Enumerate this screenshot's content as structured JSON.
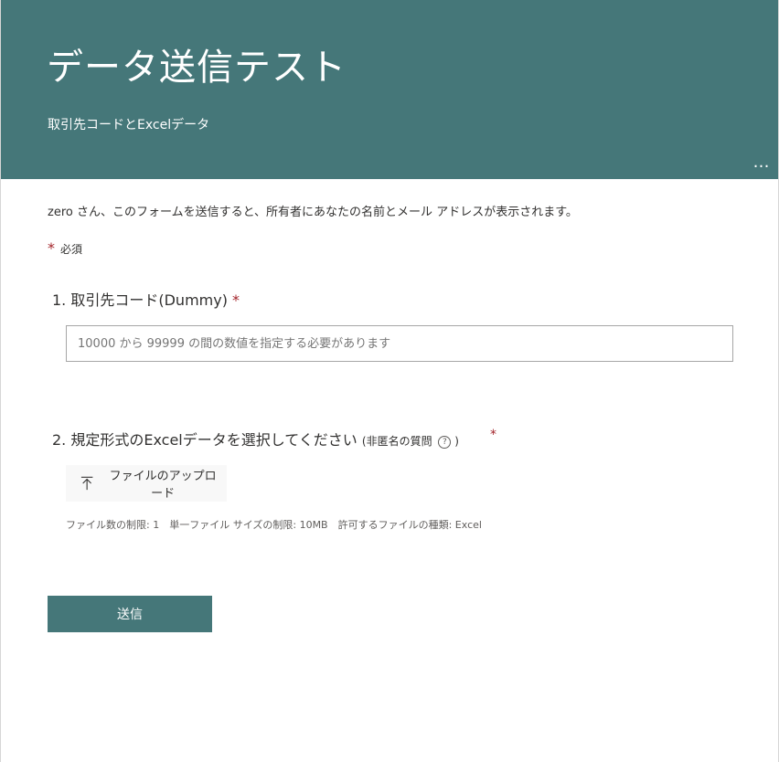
{
  "header": {
    "title": "データ送信テスト",
    "subtitle": "取引先コードとExcelデータ",
    "more_label": "…",
    "background_color": "#457779"
  },
  "notice": "zero さん、このフォームを送信すると、所有者にあなたの名前とメール アドレスが表示されます。",
  "required_legend": {
    "star": "*",
    "label": "必須"
  },
  "questions": [
    {
      "number": "1.",
      "title": "取引先コード(Dummy)",
      "required_mark": "*",
      "input_value": "",
      "placeholder": "10000 から 99999 の間の数値を指定する必要があります"
    },
    {
      "number": "2.",
      "title": "規定形式のExcelデータを選択してください",
      "note_open": "(非匿名の質問",
      "help_icon": "?",
      "note_close": ")",
      "required_mark": "*",
      "upload_label": "ファイルのアップロード",
      "upload_icon": "upload-arrow-icon",
      "limits": "ファイル数の制限: 1　単一ファイル サイズの制限: 10MB　許可するファイルの種類: Excel"
    }
  ],
  "submit_label": "送信",
  "colors": {
    "accent": "#457779",
    "required": "#a4262c"
  }
}
